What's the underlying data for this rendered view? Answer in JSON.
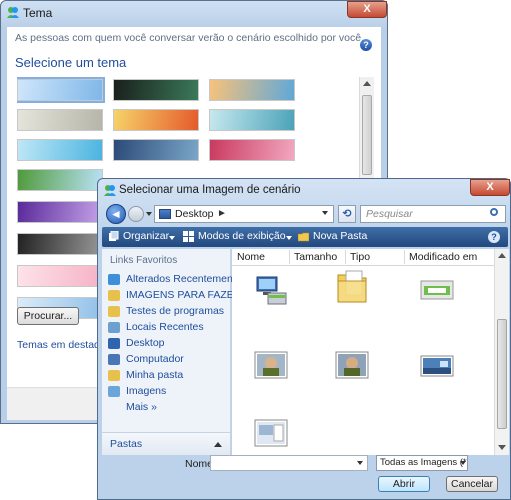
{
  "tema": {
    "title": "Tema",
    "description": "As pessoas com quem você conversar verão o cenário escolhido por você.",
    "heading": "Selecione um tema",
    "help_glyph": "?",
    "close_glyph": "X",
    "browse_label": "Procurar...",
    "featured_link": "Temas em destaque",
    "thumbnails": [
      {
        "name": "sky-blue",
        "colors": [
          "#cfe6fb",
          "#7fb7e8"
        ]
      },
      {
        "name": "dark-green",
        "colors": [
          "#1a1f1a",
          "#3a7a5a"
        ]
      },
      {
        "name": "beach-sunset",
        "colors": [
          "#f8c27a",
          "#5fa8d8"
        ]
      },
      {
        "name": "gray-floral",
        "colors": [
          "#e5e5dc",
          "#b5b5a8"
        ]
      },
      {
        "name": "circles-colorful",
        "colors": [
          "#f6d36a",
          "#e55a2b"
        ]
      },
      {
        "name": "teal-abstract",
        "colors": [
          "#c7e8ef",
          "#4aa3b8"
        ]
      },
      {
        "name": "cyan-bubbles",
        "colors": [
          "#bfe7f6",
          "#4bb4e0"
        ]
      },
      {
        "name": "blue-ocean",
        "colors": [
          "#2c4a78",
          "#7aa6c8"
        ]
      },
      {
        "name": "pink-floral",
        "colors": [
          "#c9395f",
          "#f2a7c0"
        ]
      },
      {
        "name": "green-meadow",
        "colors": [
          "#4f9a3a",
          "#b9e2f7"
        ]
      },
      {
        "name": "purple-glow",
        "colors": [
          "#5a2a9a",
          "#c4a3e8"
        ]
      },
      {
        "name": "bw-photo",
        "colors": [
          "#222222",
          "#999999"
        ]
      },
      {
        "name": "pink-light",
        "colors": [
          "#fde3ea",
          "#f6b2c4"
        ]
      },
      {
        "name": "blue-strip",
        "colors": [
          "#dcecf9",
          "#8fbfe8"
        ]
      }
    ]
  },
  "dialog": {
    "title": "Selecionar uma Imagem de cenário",
    "close_glyph": "X",
    "back_glyph": "◄",
    "address": "Desktop",
    "address_chevron": "►",
    "refresh_glyph": "⟲",
    "search_placeholder": "Pesquisar",
    "toolbar": {
      "organize": "Organizar",
      "views": "Modos de exibição",
      "new_folder": "Nova Pasta",
      "help": "?"
    },
    "nav": {
      "header": "Links Favoritos",
      "items": [
        {
          "label": "Alterados Recentemente",
          "icon": "recent-icon",
          "color": "#3e8fd8"
        },
        {
          "label": "IMAGENS PARA FAZER",
          "icon": "folder-icon",
          "color": "#e8c14d"
        },
        {
          "label": "Testes de programas",
          "icon": "folder-icon",
          "color": "#e8c14d"
        },
        {
          "label": "Locais Recentes",
          "icon": "recent-places-icon",
          "color": "#6ea0cf"
        },
        {
          "label": "Desktop",
          "icon": "desktop-icon",
          "color": "#2e64b0"
        },
        {
          "label": "Computador",
          "icon": "computer-icon",
          "color": "#4a76b7"
        },
        {
          "label": "Minha pasta",
          "icon": "folder-icon",
          "color": "#e8c14d"
        },
        {
          "label": "Imagens",
          "icon": "pictures-icon",
          "color": "#6aa6d9"
        }
      ],
      "more": "Mais  »",
      "folders": "Pastas"
    },
    "columns": {
      "name": "Nome",
      "size": "Tamanho",
      "type": "Tipo",
      "modified": "Modificado em"
    },
    "file_label": "Nome:",
    "file_value": "",
    "filter": "Todas as Imagens (*.bmp;*.gi",
    "open_label": "Abrir",
    "cancel_label": "Cancelar"
  },
  "colors": {
    "link": "#1f4d9b",
    "titlebar": "#c3d6ec",
    "toolbar": "#2f5c96"
  }
}
